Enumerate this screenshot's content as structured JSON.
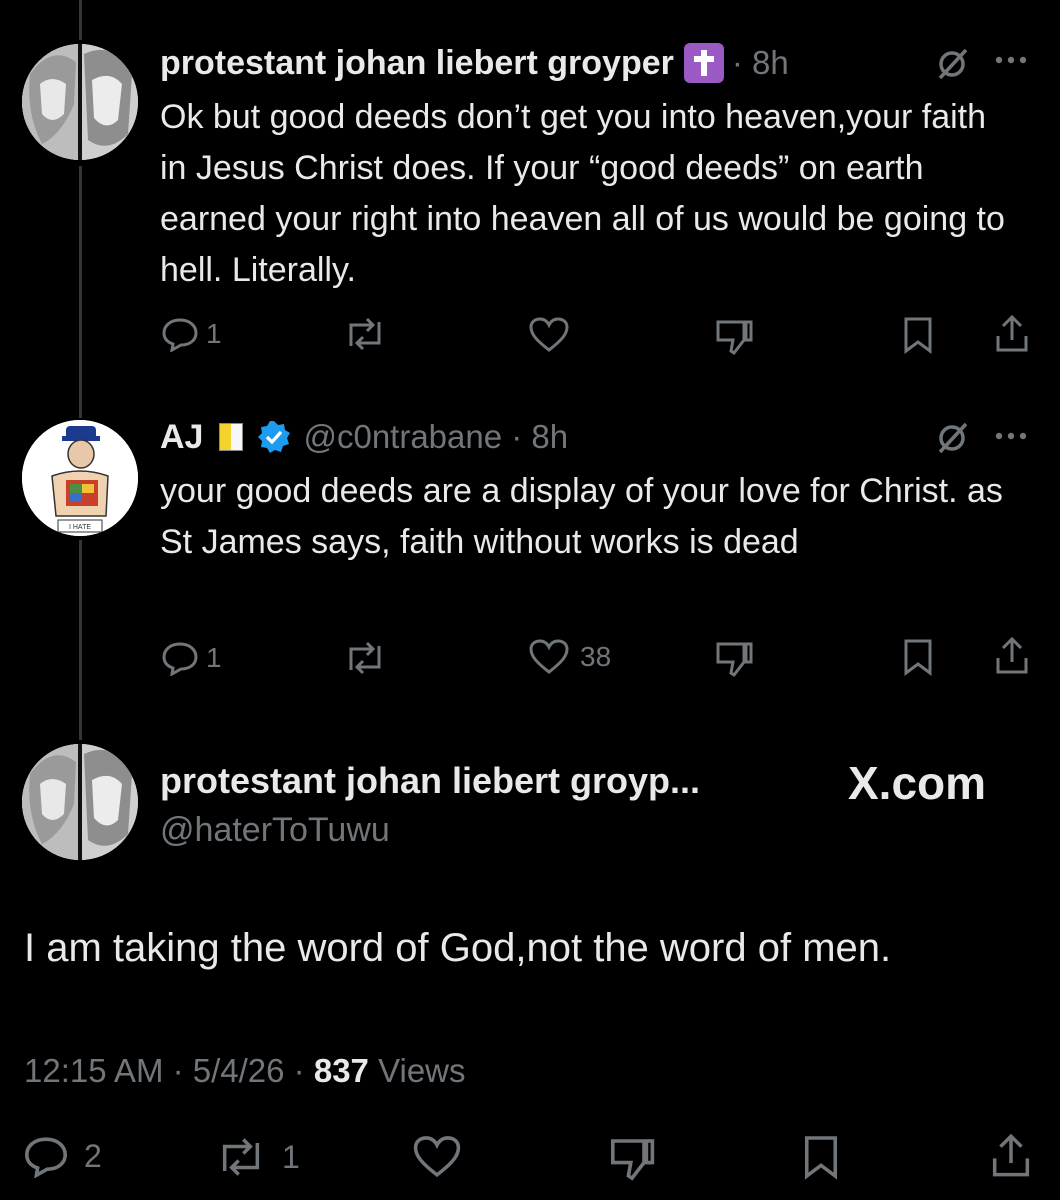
{
  "reply1": {
    "name": "protestant johan liebert groyper",
    "badge_icon": "latin-cross-emoji",
    "time": "· 8h",
    "text": "Ok but good deeds don’t get you into heaven,your faith in Jesus Christ does. If your “good deeds” on earth earned your right into heaven all of us would be going to hell. Literally.",
    "replies": "1"
  },
  "reply2": {
    "name": "AJ",
    "flag_icon": "vatican-flag",
    "handle_time": "@c0ntrabane · 8h",
    "text": "your good deeds are a display of your love for Christ. as St James says, faith without works is dead",
    "replies": "1",
    "likes": "38"
  },
  "main": {
    "name": "protestant johan liebert groyp...",
    "handle": "@haterToTuwu",
    "source": "X.com",
    "text": "I am taking the word of God,not the word of men.",
    "time": "12:15 AM · 5/4/26 ·",
    "views_count": "837",
    "views_label": "Views",
    "replies": "2",
    "reposts": "1"
  },
  "colors": {
    "background": "#000000",
    "text": "#e7e9ea",
    "muted": "#71767b",
    "verified": "#1d9bf0"
  }
}
